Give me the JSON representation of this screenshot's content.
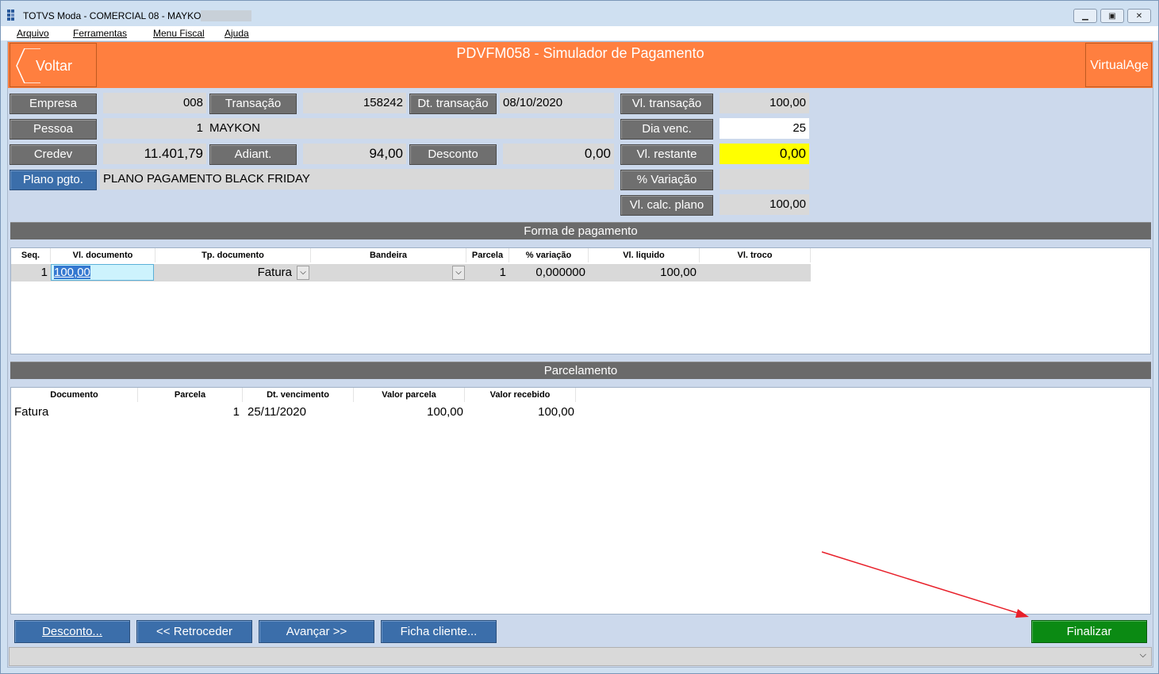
{
  "window": {
    "title": "TOTVS Moda - COMERCIAL 08 - MAYKON",
    "controls": {
      "minimize_icon": "minimize-icon",
      "restore_icon": "restore-icon",
      "close_icon": "close-icon"
    }
  },
  "menu": [
    "Arquivo",
    "Ferramentas",
    "Menu Fiscal",
    "Ajuda"
  ],
  "header": {
    "back_label": "Voltar",
    "form_title": "PDVFM058 - Simulador de Pagamento",
    "brand_label": "VirtualAge",
    "color": "#ff7f3f"
  },
  "fields": {
    "empresa_label": "Empresa",
    "empresa_value": "008",
    "transacao_label": "Transação",
    "transacao_value": "158242",
    "dt_transacao_label": "Dt. transação",
    "dt_transacao_value": "08/10/2020",
    "vl_transacao_label": "Vl. transação",
    "vl_transacao_value": "100,00",
    "pessoa_label": "Pessoa",
    "pessoa_code": "1",
    "pessoa_name": "MAYKON",
    "dia_venc_label": "Dia venc.",
    "dia_venc_value": "25",
    "credev_label": "Credev",
    "credev_value": "11.401,79",
    "adiant_label": "Adiant.",
    "adiant_value": "94,00",
    "desconto_label": "Desconto",
    "desconto_value": "0,00",
    "vl_restante_label": "Vl. restante",
    "vl_restante_value": "0,00",
    "plano_label": "Plano pgto.",
    "plano_value": "PLANO PAGAMENTO BLACK FRIDAY",
    "variacao_label": "% Variação",
    "variacao_value": "",
    "vl_calc_label": "Vl. calc. plano",
    "vl_calc_value": "100,00"
  },
  "forma_pagamento": {
    "title": "Forma de pagamento",
    "columns": [
      "Seq.",
      "Vl. documento",
      "Tp. documento",
      "Bandeira",
      "Parcela",
      "% variação",
      "Vl. liquido",
      "Vl. troco"
    ],
    "rows": [
      {
        "seq": "1",
        "vl_documento": "100,00",
        "tp_documento": "Fatura",
        "bandeira": "",
        "parcela": "1",
        "variacao": "0,000000",
        "vl_liquido": "100,00",
        "vl_troco": ""
      }
    ]
  },
  "parcelamento": {
    "title": "Parcelamento",
    "columns": [
      "Documento",
      "Parcela",
      "Dt. vencimento",
      "Valor parcela",
      "Valor recebido"
    ],
    "rows": [
      {
        "documento": "Fatura",
        "parcela": "1",
        "dt_vencimento": "25/11/2020",
        "valor_parcela": "100,00",
        "valor_recebido": "100,00"
      }
    ]
  },
  "actions": {
    "desconto": "Desconto...",
    "retroceder": "<< Retroceder",
    "avancar": "Avançar >>",
    "ficha_cliente": "Ficha cliente...",
    "finalizar": "Finalizar"
  },
  "colors": {
    "finalizar": "#0b8a13",
    "action_blue": "#3b6eaa",
    "annotation_arrow": "#e8202a",
    "vl_restante_bg": "#ffff00"
  }
}
